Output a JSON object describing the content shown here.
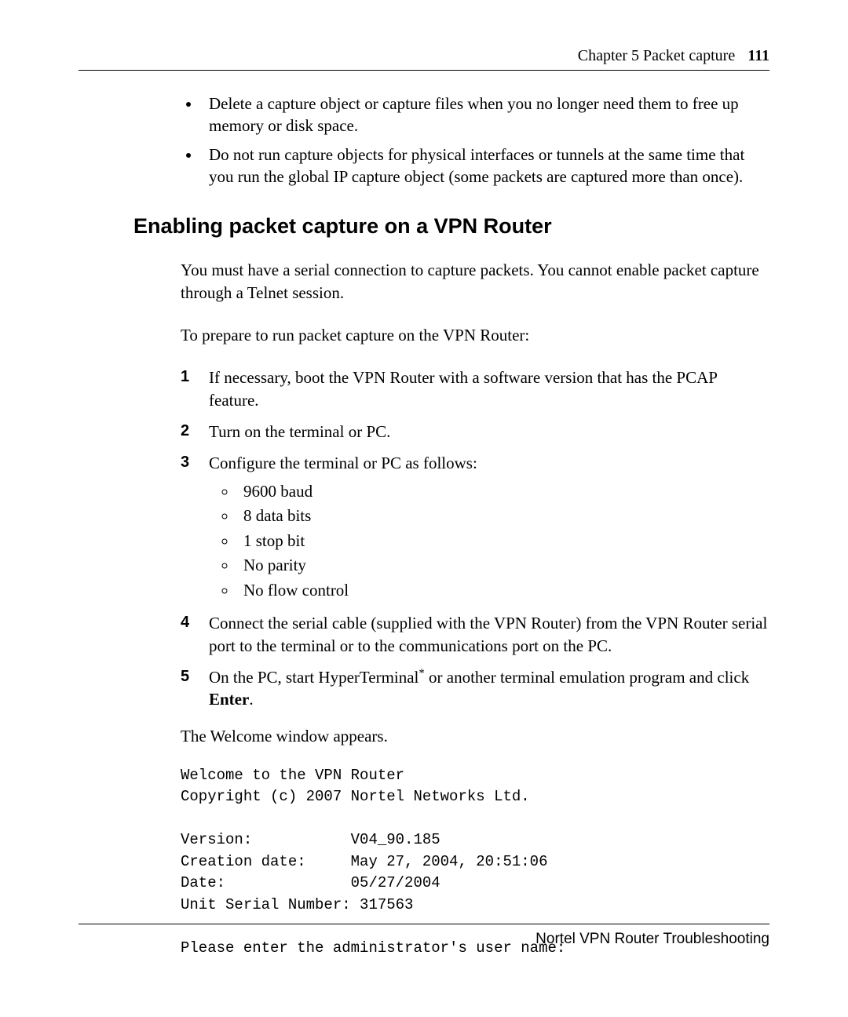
{
  "header": {
    "chapter": "Chapter 5  Packet capture",
    "page": "111"
  },
  "intro_bullets": [
    "Delete a capture object or capture files when you no longer need them to free up memory or disk space.",
    "Do not run capture objects for physical interfaces or tunnels at the same time that you run the global IP capture object (some packets are captured more than once)."
  ],
  "heading": "Enabling packet capture on a VPN Router",
  "para1": "You must have a serial connection to capture packets. You cannot enable packet capture through a Telnet session.",
  "para2": "To prepare to run packet capture on the VPN Router:",
  "steps": {
    "s1": "If necessary, boot the VPN Router with a software version that has the PCAP feature.",
    "s2": "Turn on the terminal or PC.",
    "s3": "Configure the terminal or PC as follows:",
    "s3_sub": [
      "9600 baud",
      "8 data bits",
      "1 stop bit",
      "No parity",
      "No flow control"
    ],
    "s4": "Connect the serial cable (supplied with the VPN Router) from the VPN Router serial port to the terminal or to the communications port on the PC.",
    "s5_a": "On the PC, start HyperTerminal",
    "s5_ast": "*",
    "s5_b": " or another terminal emulation program and click ",
    "s5_bold": "Enter",
    "s5_c": "."
  },
  "after_steps": "The Welcome window appears.",
  "terminal": "Welcome to the VPN Router\nCopyright (c) 2007 Nortel Networks Ltd.\n\nVersion:           V04_90.185\nCreation date:     May 27, 2004, 20:51:06\nDate:              05/27/2004\nUnit Serial Number: 317563\n\nPlease enter the administrator's user name:",
  "footer": "Nortel VPN Router Troubleshooting"
}
